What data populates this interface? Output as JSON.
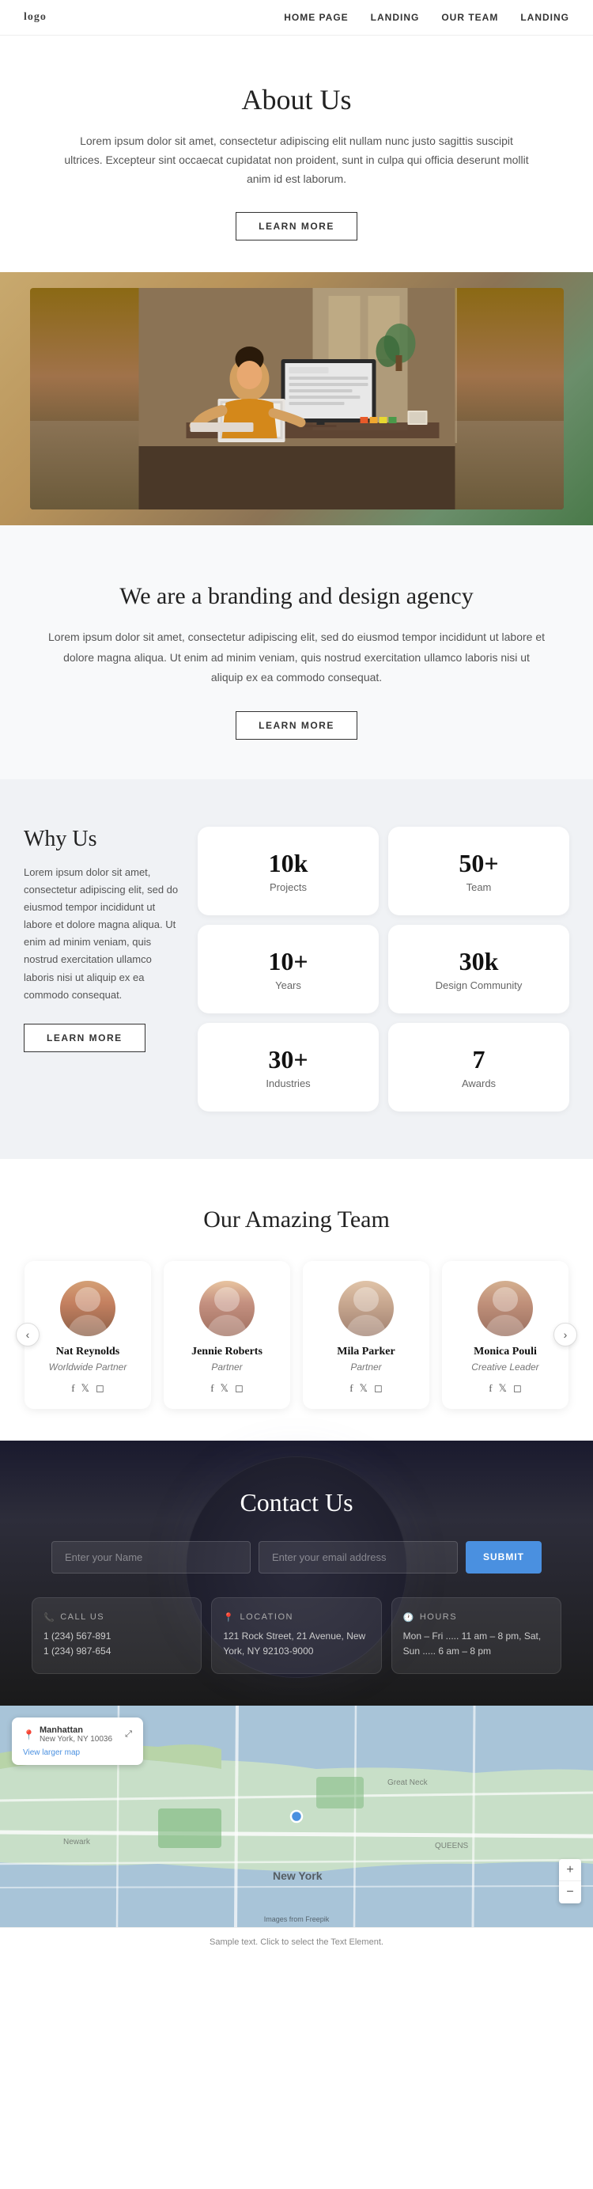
{
  "nav": {
    "logo": "logo",
    "links": [
      "HOME PAGE",
      "LANDING",
      "OUR TEAM",
      "LANDING"
    ]
  },
  "about": {
    "title": "About Us",
    "description": "Lorem ipsum dolor sit amet, consectetur adipiscing elit nullam nunc justo sagittis suscipit ultrices. Excepteur sint occaecat cupidatat non proident, sunt in culpa qui officia deserunt mollit anim id est laborum.",
    "button": "LEARN MORE"
  },
  "branding": {
    "title": "We are a branding and design agency",
    "description": "Lorem ipsum dolor sit amet, consectetur adipiscing elit, sed do eiusmod tempor incididunt ut labore et dolore magna aliqua. Ut enim ad minim veniam, quis nostrud exercitation ullamco laboris nisi ut aliquip ex ea commodo consequat.",
    "button": "LEARN MORE"
  },
  "whyUs": {
    "title": "Why Us",
    "description": "Lorem ipsum dolor sit amet, consectetur adipiscing elit, sed do eiusmod tempor incididunt ut labore et dolore magna aliqua. Ut enim ad minim veniam, quis nostrud exercitation ullamco laboris nisi ut aliquip ex ea commodo consequat.",
    "button": "LEARN MORE",
    "stats": [
      {
        "number": "10k",
        "label": "Projects"
      },
      {
        "number": "50+",
        "label": "Team"
      },
      {
        "number": "10+",
        "label": "Years"
      },
      {
        "number": "30k",
        "label": "Design Community"
      },
      {
        "number": "30+",
        "label": "Industries"
      },
      {
        "number": "7",
        "label": "Awards"
      }
    ]
  },
  "team": {
    "title": "Our Amazing Team",
    "more_label": "More",
    "members": [
      {
        "name": "Nat Reynolds",
        "role": "Worldwide Partner"
      },
      {
        "name": "Jennie Roberts",
        "role": "Partner"
      },
      {
        "name": "Mila Parker",
        "role": "Partner"
      },
      {
        "name": "Monica Pouli",
        "role": "Creative Leader"
      }
    ]
  },
  "contact": {
    "title": "Contact Us",
    "name_placeholder": "Enter your Name",
    "email_placeholder": "Enter your email address",
    "submit_label": "SUBMIT",
    "call_us_title": "CALL US",
    "call_us_phone1": "1 (234) 567-891",
    "call_us_phone2": "1 (234) 987-654",
    "location_title": "LOCATION",
    "location_address": "121 Rock Street, 21 Avenue, New York, NY 92103-9000",
    "hours_title": "HOURS",
    "hours_text": "Mon – Fri ..... 11 am – 8 pm, Sat, Sun ..... 6 am – 8 pm"
  },
  "map": {
    "location_title": "Manhattan",
    "location_subtitle": "New York, NY 10036",
    "view_map_link": "View larger map",
    "label": "New York",
    "attribution": "Images from Freepik"
  },
  "footer": {
    "note": "Sample text. Click to select the Text Element."
  }
}
